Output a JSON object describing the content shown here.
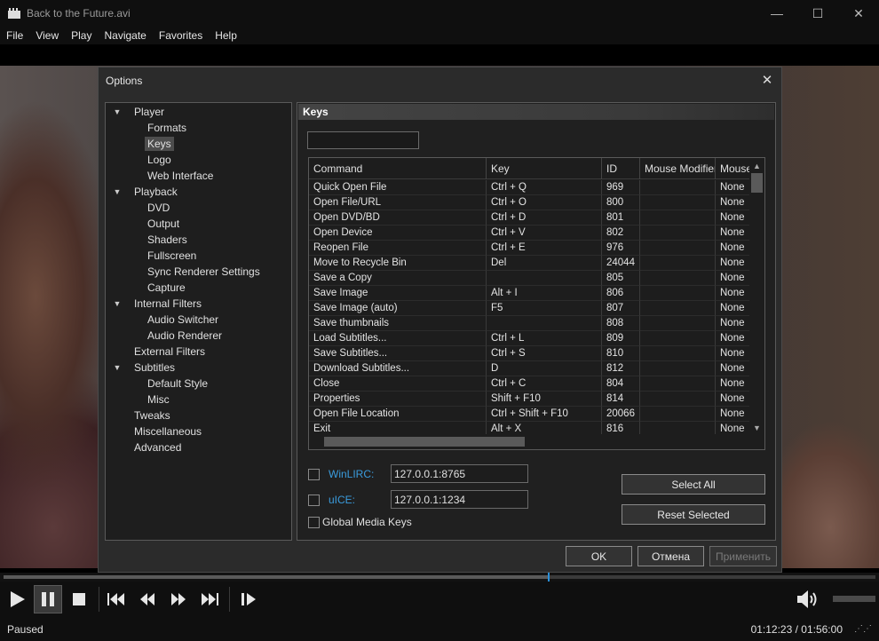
{
  "window": {
    "title": "Back to the Future.avi",
    "controls": {
      "minimize": "—",
      "maximize": "☐",
      "close": "✕"
    }
  },
  "menu": [
    "File",
    "View",
    "Play",
    "Navigate",
    "Favorites",
    "Help"
  ],
  "dialog": {
    "title": "Options",
    "close": "✕",
    "tree": [
      {
        "label": "Player",
        "level": 0,
        "expanded": true
      },
      {
        "label": "Formats",
        "level": 1
      },
      {
        "label": "Keys",
        "level": 1,
        "selected": true
      },
      {
        "label": "Logo",
        "level": 1
      },
      {
        "label": "Web Interface",
        "level": 1
      },
      {
        "label": "Playback",
        "level": 0,
        "expanded": true
      },
      {
        "label": "DVD",
        "level": 1
      },
      {
        "label": "Output",
        "level": 1
      },
      {
        "label": "Shaders",
        "level": 1
      },
      {
        "label": "Fullscreen",
        "level": 1
      },
      {
        "label": "Sync Renderer Settings",
        "level": 1
      },
      {
        "label": "Capture",
        "level": 1
      },
      {
        "label": "Internal Filters",
        "level": 0,
        "expanded": true
      },
      {
        "label": "Audio Switcher",
        "level": 1
      },
      {
        "label": "Audio Renderer",
        "level": 1
      },
      {
        "label": "External Filters",
        "level": 0
      },
      {
        "label": "Subtitles",
        "level": 0,
        "expanded": true
      },
      {
        "label": "Default Style",
        "level": 1
      },
      {
        "label": "Misc",
        "level": 1
      },
      {
        "label": "Tweaks",
        "level": 0
      },
      {
        "label": "Miscellaneous",
        "level": 0
      },
      {
        "label": "Advanced",
        "level": 0
      }
    ],
    "page": {
      "header": "Keys",
      "filter_value": "",
      "columns": [
        "Command",
        "Key",
        "ID",
        "Mouse Modifier",
        "Mouse"
      ],
      "rows": [
        [
          "Quick Open File",
          "Ctrl + Q",
          "969",
          "",
          "None"
        ],
        [
          "Open File/URL",
          "Ctrl + O",
          "800",
          "",
          "None"
        ],
        [
          "Open DVD/BD",
          "Ctrl + D",
          "801",
          "",
          "None"
        ],
        [
          "Open Device",
          "Ctrl + V",
          "802",
          "",
          "None"
        ],
        [
          "Reopen File",
          "Ctrl + E",
          "976",
          "",
          "None"
        ],
        [
          "Move to Recycle Bin",
          "Del",
          "24044",
          "",
          "None"
        ],
        [
          "Save a Copy",
          "",
          "805",
          "",
          "None"
        ],
        [
          "Save Image",
          "Alt + I",
          "806",
          "",
          "None"
        ],
        [
          "Save Image (auto)",
          "F5",
          "807",
          "",
          "None"
        ],
        [
          "Save thumbnails",
          "",
          "808",
          "",
          "None"
        ],
        [
          "Load Subtitles...",
          "Ctrl + L",
          "809",
          "",
          "None"
        ],
        [
          "Save Subtitles...",
          "Ctrl + S",
          "810",
          "",
          "None"
        ],
        [
          "Download Subtitles...",
          "D",
          "812",
          "",
          "None"
        ],
        [
          "Close",
          "Ctrl + C",
          "804",
          "",
          "None"
        ],
        [
          "Properties",
          "Shift + F10",
          "814",
          "",
          "None"
        ],
        [
          "Open File Location",
          "Ctrl + Shift + F10",
          "20066",
          "",
          "None"
        ],
        [
          "Exit",
          "Alt + X",
          "816",
          "",
          "None"
        ]
      ],
      "winlirc": {
        "label": "WinLIRC:",
        "value": "127.0.0.1:8765",
        "checked": false
      },
      "uice": {
        "label": "uICE:",
        "value": "127.0.0.1:1234",
        "checked": false
      },
      "global_media_keys": {
        "label": "Global Media Keys",
        "checked": false
      },
      "select_all": "Select All",
      "reset_selected": "Reset Selected"
    },
    "buttons": {
      "ok": "OK",
      "cancel": "Отмена",
      "apply": "Применить"
    }
  },
  "player": {
    "progress": 0.624,
    "status": "Paused",
    "time": "01:12:23 / 01:56:00",
    "volume": 0,
    "accent": "#2a8fd8"
  }
}
